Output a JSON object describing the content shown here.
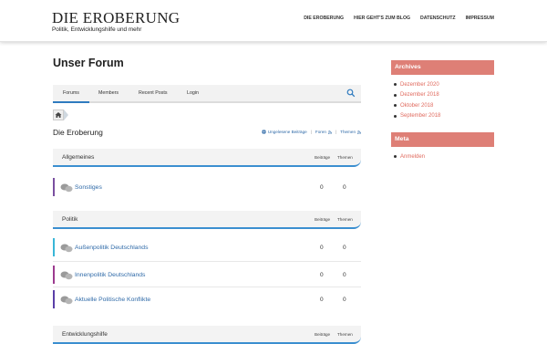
{
  "site": {
    "title": "DIE EROBERUNG",
    "tagline": "Politik, Entwicklungshilfe und mehr"
  },
  "topnav": [
    "DIE EROBERUNG",
    "HIER GEHT'S ZUM BLOG",
    "DATENSCHUTZ",
    "IMPRESSUM"
  ],
  "main": {
    "page_title": "Unser Forum",
    "tabs": [
      "Forums",
      "Members",
      "Recent Posts",
      "Login"
    ],
    "active_tab": "Forums",
    "forum_heading": "Die Eroberung",
    "feed_links": [
      "Ungelesene Beiträge",
      "Foren",
      "Themen"
    ]
  },
  "categories": [
    {
      "name": "Allgemeines",
      "col_posts": "Beiträge",
      "col_topics": "Themen",
      "forums": [
        {
          "name": "Sonstiges",
          "posts": "0",
          "topics": "0",
          "color": "#7a4fa0"
        }
      ]
    },
    {
      "name": "Politik",
      "col_posts": "Beiträge",
      "col_topics": "Themen",
      "forums": [
        {
          "name": "Außenpolitik Deutschlands",
          "posts": "0",
          "topics": "0",
          "color": "#39b6d8"
        },
        {
          "name": "Innenpolitik Deutschlands",
          "posts": "0",
          "topics": "0",
          "color": "#9c3b8f"
        },
        {
          "name": "Aktuelle Politische Konflikte",
          "posts": "0",
          "topics": "0",
          "color": "#5b3fa8"
        }
      ]
    },
    {
      "name": "Entwicklungshilfe",
      "col_posts": "Beiträge",
      "col_topics": "Themen",
      "forums": []
    }
  ],
  "sidebar": {
    "archives_title": "Archives",
    "archives": [
      "Dezember 2020",
      "Dezember 2018",
      "Oktober 2018",
      "September 2018"
    ],
    "meta_title": "Meta",
    "meta": [
      "Anmelden"
    ]
  },
  "colors": {
    "accent": "#de7f76",
    "link": "#2f6aa8",
    "category_line": "#3b8fd0"
  },
  "icons": [
    "search-icon",
    "home-icon",
    "chat-bubbles-icon",
    "rss-icon",
    "globe-icon"
  ]
}
